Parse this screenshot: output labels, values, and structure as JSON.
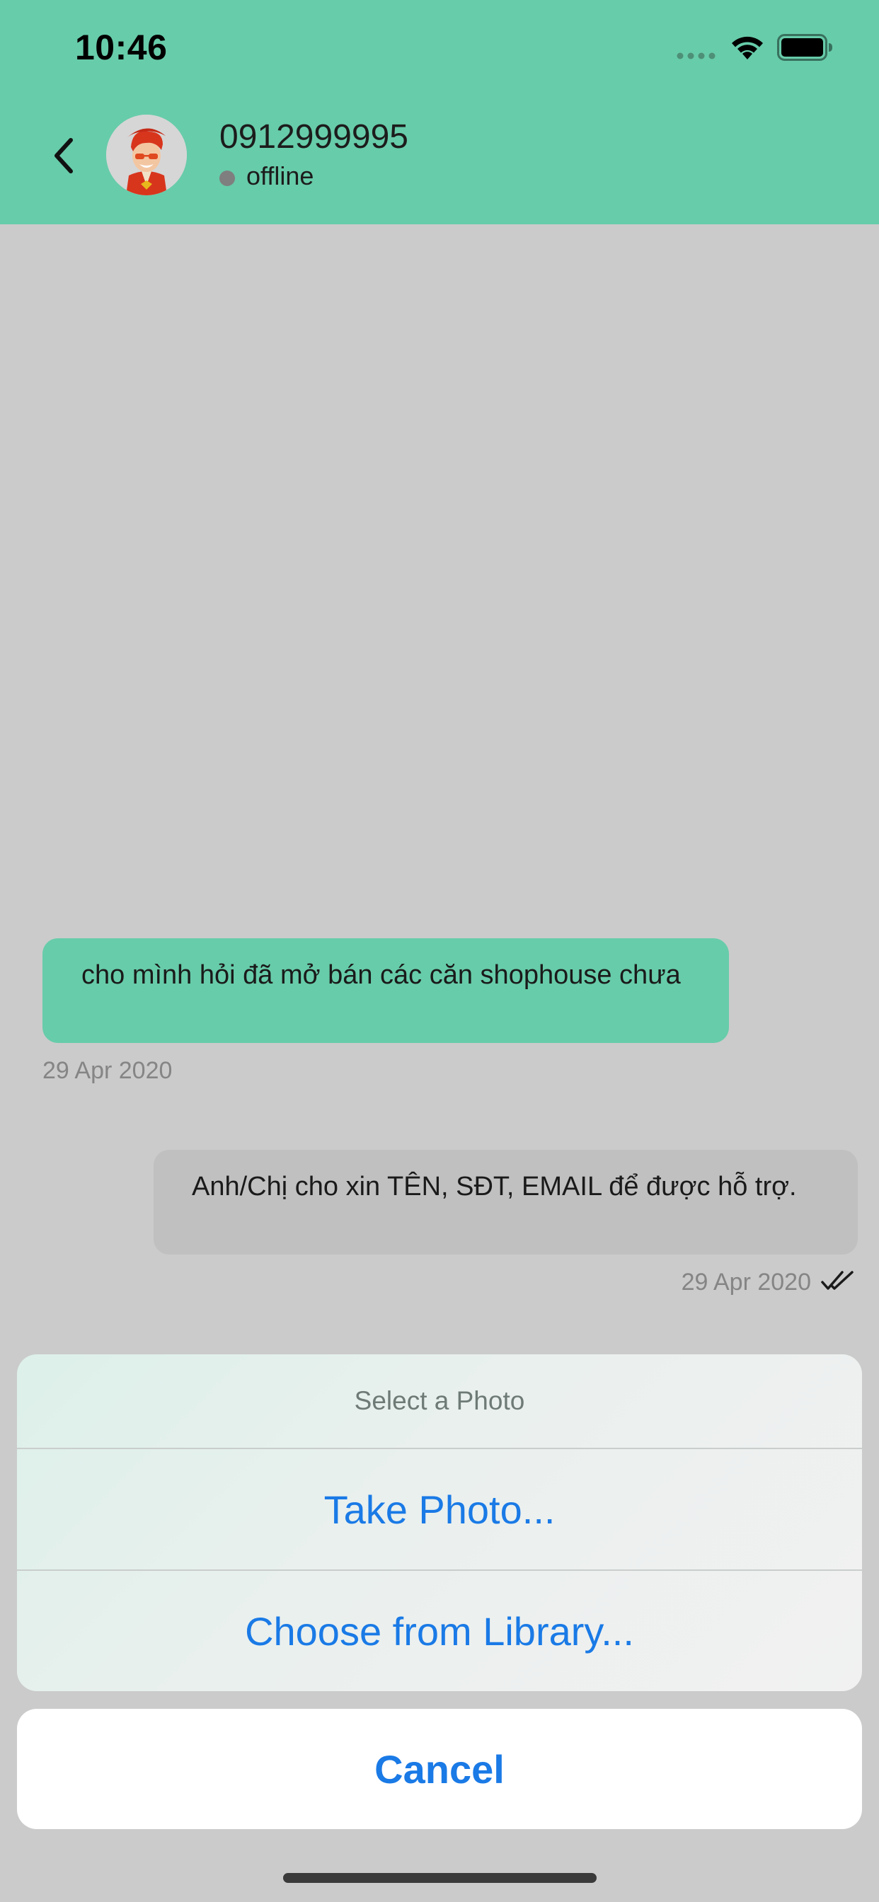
{
  "status_bar": {
    "time": "10:46",
    "icons": [
      "signal-dots-icon",
      "wifi-icon",
      "battery-icon"
    ]
  },
  "header": {
    "back_icon": "chevron-left-icon",
    "avatar_icon": "user-avatar-icon",
    "contact_name": "0912999995",
    "presence": "offline"
  },
  "messages": [
    {
      "direction": "incoming",
      "text": "cho mình hỏi đã mở bán các căn shophouse chưa",
      "time": "29 Apr 2020"
    },
    {
      "direction": "outgoing",
      "text": "Anh/Chị cho xin TÊN, SĐT, EMAIL để được hỗ trợ.",
      "time": "29 Apr 2020",
      "status_icon": "double-check-icon"
    }
  ],
  "action_sheet": {
    "title": "Select a Photo",
    "options": [
      "Take Photo...",
      "Choose from Library..."
    ],
    "cancel_label": "Cancel"
  },
  "colors": {
    "header_bg": "#67cca9",
    "incoming_bubble": "#67cca9",
    "outgoing_bubble": "#c0c0c0",
    "dim_background": "#cbcbcb",
    "action_text": "#1a7ae6"
  }
}
